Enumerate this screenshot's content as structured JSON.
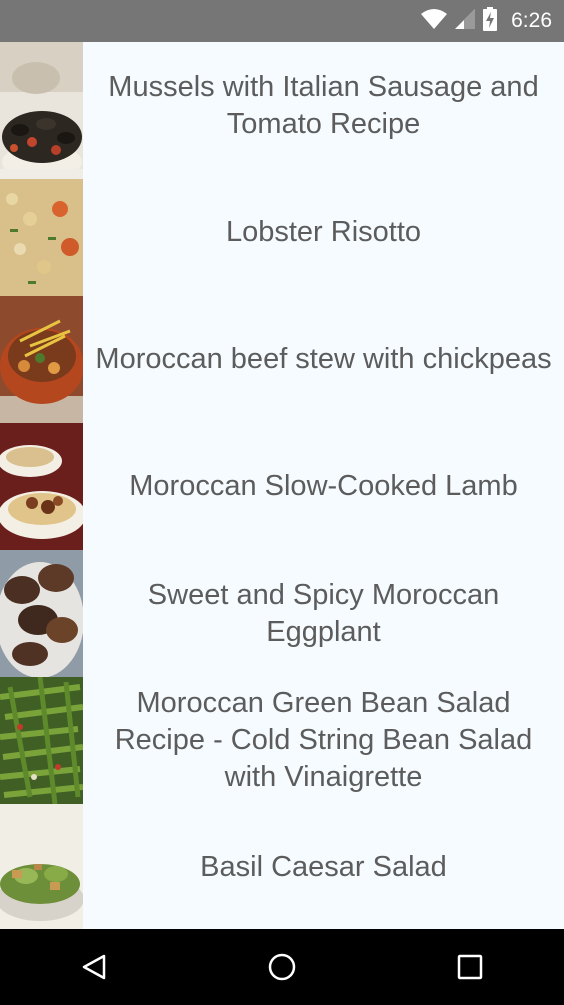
{
  "status_bar": {
    "time": "6:26",
    "icons": [
      "wifi-icon",
      "signal-icon",
      "battery-charging-icon"
    ]
  },
  "recipes": [
    {
      "title": "Mussels with Italian Sausage and Tomato Recipe",
      "image": "mussels-photo"
    },
    {
      "title": "Lobster Risotto",
      "image": "lobster-risotto-photo"
    },
    {
      "title": "Moroccan beef stew with chickpeas",
      "image": "beef-stew-photo"
    },
    {
      "title": "Moroccan Slow-Cooked Lamb",
      "image": "lamb-photo"
    },
    {
      "title": "Sweet and Spicy Moroccan Eggplant",
      "image": "eggplant-photo"
    },
    {
      "title": "Moroccan Green Bean Salad Recipe - Cold String Bean Salad with Vinaigrette",
      "image": "green-bean-salad-photo"
    },
    {
      "title": "Basil Caesar Salad",
      "image": "caesar-salad-photo"
    }
  ],
  "nav_bar": {
    "buttons": [
      "back-icon",
      "home-icon",
      "recents-icon"
    ]
  },
  "colors": {
    "status_bar": "#767676",
    "list_background": "#f5fbff",
    "title_text": "#5c5c5c",
    "nav_bar": "#000000"
  }
}
